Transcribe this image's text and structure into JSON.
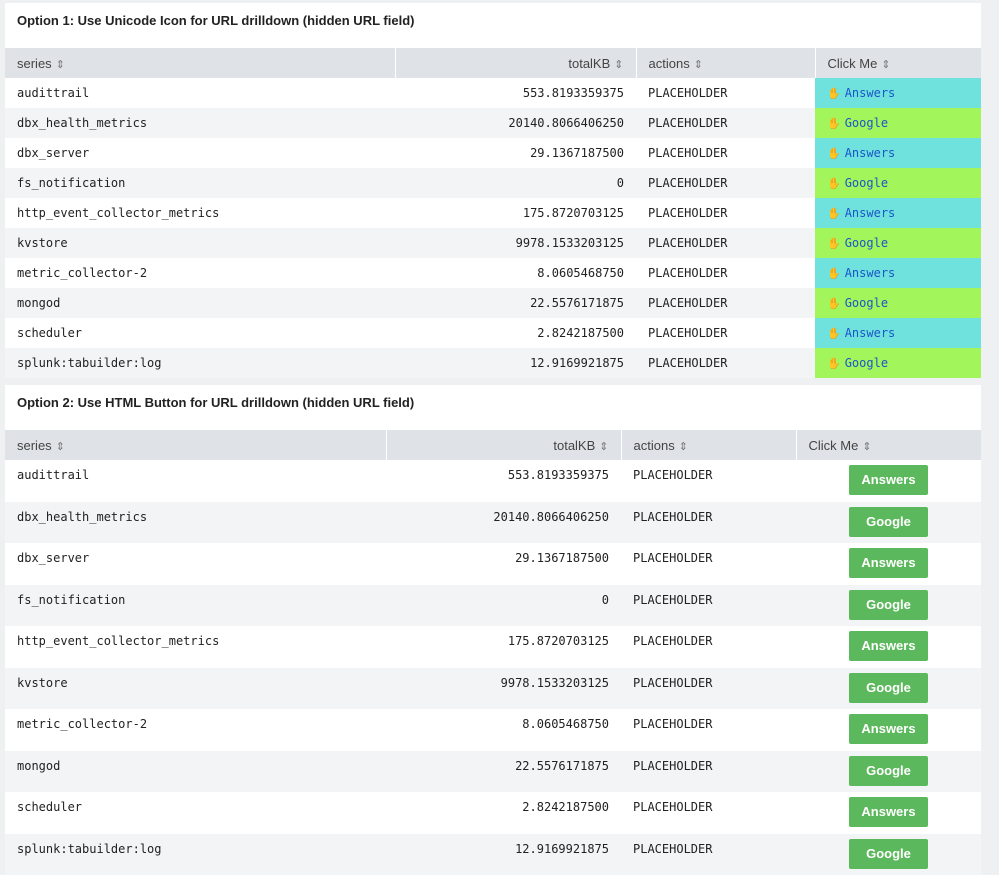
{
  "option1": {
    "title": "Option 1: Use Unicode Icon for URL drilldown (hidden URL field)",
    "columns": [
      "series",
      "totalKB",
      "actions",
      "Click Me"
    ],
    "icon_glyph": "✋",
    "rows": [
      {
        "series": "audittrail",
        "totalKB": "553.8193359375",
        "actions": "PLACEHOLDER",
        "click": "Answers"
      },
      {
        "series": "dbx_health_metrics",
        "totalKB": "20140.8066406250",
        "actions": "PLACEHOLDER",
        "click": "Google"
      },
      {
        "series": "dbx_server",
        "totalKB": "29.1367187500",
        "actions": "PLACEHOLDER",
        "click": "Answers"
      },
      {
        "series": "fs_notification",
        "totalKB": "0",
        "actions": "PLACEHOLDER",
        "click": "Google"
      },
      {
        "series": "http_event_collector_metrics",
        "totalKB": "175.8720703125",
        "actions": "PLACEHOLDER",
        "click": "Answers"
      },
      {
        "series": "kvstore",
        "totalKB": "9978.1533203125",
        "actions": "PLACEHOLDER",
        "click": "Google"
      },
      {
        "series": "metric_collector-2",
        "totalKB": "8.0605468750",
        "actions": "PLACEHOLDER",
        "click": "Answers"
      },
      {
        "series": "mongod",
        "totalKB": "22.5576171875",
        "actions": "PLACEHOLDER",
        "click": "Google"
      },
      {
        "series": "scheduler",
        "totalKB": "2.8242187500",
        "actions": "PLACEHOLDER",
        "click": "Answers"
      },
      {
        "series": "splunk:tabuilder:log",
        "totalKB": "12.9169921875",
        "actions": "PLACEHOLDER",
        "click": "Google"
      }
    ]
  },
  "option2": {
    "title": "Option 2: Use HTML Button for URL drilldown (hidden URL field)",
    "columns": [
      "series",
      "totalKB",
      "actions",
      "Click Me"
    ],
    "rows": [
      {
        "series": "audittrail",
        "totalKB": "553.8193359375",
        "actions": "PLACEHOLDER",
        "click": "Answers"
      },
      {
        "series": "dbx_health_metrics",
        "totalKB": "20140.8066406250",
        "actions": "PLACEHOLDER",
        "click": "Google"
      },
      {
        "series": "dbx_server",
        "totalKB": "29.1367187500",
        "actions": "PLACEHOLDER",
        "click": "Answers"
      },
      {
        "series": "fs_notification",
        "totalKB": "0",
        "actions": "PLACEHOLDER",
        "click": "Google"
      },
      {
        "series": "http_event_collector_metrics",
        "totalKB": "175.8720703125",
        "actions": "PLACEHOLDER",
        "click": "Answers"
      },
      {
        "series": "kvstore",
        "totalKB": "9978.1533203125",
        "actions": "PLACEHOLDER",
        "click": "Google"
      },
      {
        "series": "metric_collector-2",
        "totalKB": "8.0605468750",
        "actions": "PLACEHOLDER",
        "click": "Answers"
      },
      {
        "series": "mongod",
        "totalKB": "22.5576171875",
        "actions": "PLACEHOLDER",
        "click": "Google"
      },
      {
        "series": "scheduler",
        "totalKB": "2.8242187500",
        "actions": "PLACEHOLDER",
        "click": "Answers"
      },
      {
        "series": "splunk:tabuilder:log",
        "totalKB": "12.9169921875",
        "actions": "PLACEHOLDER",
        "click": "Google"
      }
    ]
  },
  "colors": {
    "answers_cell": "#6fe2dd",
    "google_cell": "#a3f55c",
    "link_text": "#1a55c9",
    "button_bg": "#5cb85c",
    "header_bg": "#dfe3e7"
  },
  "sort_icon": "⇕"
}
